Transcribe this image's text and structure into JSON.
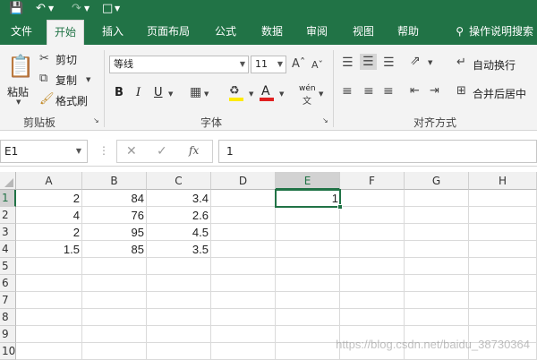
{
  "ribbon": {
    "tabs": [
      "文件",
      "开始",
      "插入",
      "页面布局",
      "公式",
      "数据",
      "审阅",
      "视图",
      "帮助"
    ],
    "active_tab": "开始",
    "tell_me": "操作说明搜索",
    "clipboard": {
      "paste": "粘贴",
      "cut": "剪切",
      "copy": "复制",
      "format_painter": "格式刷",
      "group": "剪贴板"
    },
    "font": {
      "name": "等线",
      "size": "11",
      "bold": "B",
      "italic": "I",
      "underline": "U",
      "wen": "wén",
      "group": "字体"
    },
    "alignment": {
      "wrap_text": "自动换行",
      "merge_center": "合并后居中",
      "group": "对齐方式"
    }
  },
  "formula_bar": {
    "name_box": "E1",
    "fx": "fx",
    "value": "1"
  },
  "sheet": {
    "columns": [
      "A",
      "B",
      "C",
      "D",
      "E",
      "F",
      "G",
      "H"
    ],
    "rows": [
      "1",
      "2",
      "3",
      "4",
      "5",
      "6",
      "7",
      "8",
      "9",
      "10"
    ],
    "selected_cell": "E1",
    "cells": {
      "A": [
        "2",
        "4",
        "2",
        "1.5"
      ],
      "B": [
        "84",
        "76",
        "95",
        "85"
      ],
      "C": [
        "3.4",
        "2.6",
        "4.5",
        "3.5"
      ],
      "E1": "1"
    }
  },
  "watermark": "https://blog.csdn.net/baidu_38730364",
  "colors": {
    "accent": "#217346",
    "ribbon_bg": "#f3f3f3",
    "header_bg": "#f1f1f1"
  }
}
